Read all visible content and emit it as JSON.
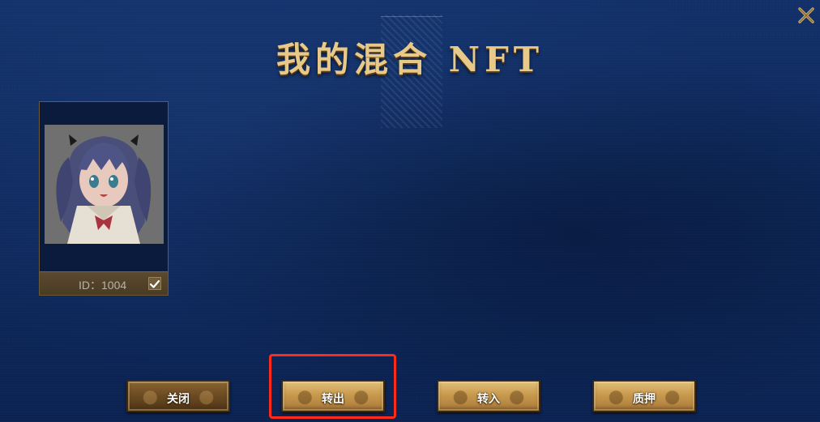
{
  "dialog": {
    "title": "我的混合 NFT"
  },
  "nft_list": [
    {
      "id_label": "ID：1004",
      "selected": true,
      "image_icon": "anime-girl-portrait"
    }
  ],
  "buttons": {
    "close_label": "关闭",
    "transfer_out_label": "转出",
    "transfer_in_label": "转入",
    "pledge_label": "质押"
  },
  "icons": {
    "close": "close-icon",
    "checkbox": "check-icon"
  },
  "colors": {
    "title": "#e7c98a",
    "background": "#0e2a5e",
    "button_gold": "#c89a4e",
    "highlight": "#ff2a1a"
  }
}
